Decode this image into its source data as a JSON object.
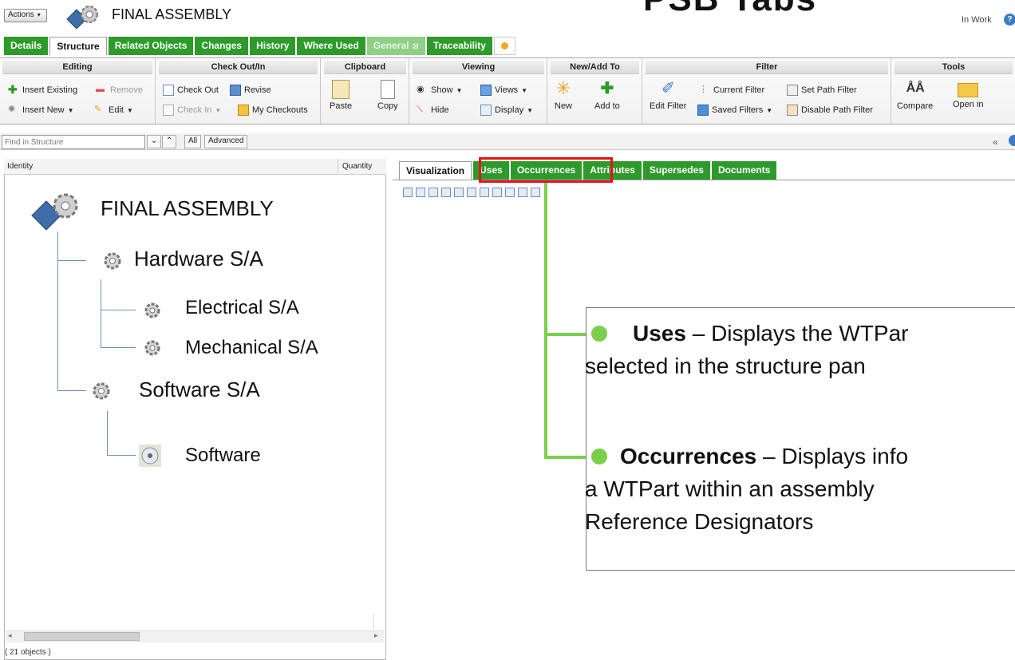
{
  "header": {
    "actions_label": "Actions",
    "title": "FINAL ASSEMBLY",
    "overlay_title": "PSB Tabs",
    "status": "In Work"
  },
  "tabs": [
    {
      "label": "Details"
    },
    {
      "label": "Structure",
      "active": true
    },
    {
      "label": "Related Objects"
    },
    {
      "label": "Changes"
    },
    {
      "label": "History"
    },
    {
      "label": "Where Used"
    },
    {
      "label": "General",
      "dim": true,
      "close": "⊠"
    },
    {
      "label": "Traceability"
    }
  ],
  "ribbon": {
    "editing": {
      "title": "Editing",
      "insert_existing": "Insert Existing",
      "remove": "Remove",
      "insert_new": "Insert New",
      "edit": "Edit"
    },
    "checkout": {
      "title": "Check Out/In",
      "check_out": "Check Out",
      "revise": "Revise",
      "check_in": "Check In",
      "my_checkouts": "My Checkouts"
    },
    "clipboard": {
      "title": "Clipboard",
      "paste": "Paste",
      "copy": "Copy"
    },
    "viewing": {
      "title": "Viewing",
      "show": "Show",
      "views": "Views",
      "hide": "Hide",
      "display": "Display"
    },
    "newadd": {
      "title": "New/Add To",
      "new": "New",
      "add_to": "Add to"
    },
    "filter": {
      "title": "Filter",
      "edit_filter": "Edit Filter",
      "current_filter": "Current Filter",
      "set_path_filter": "Set Path Filter",
      "saved_filters": "Saved Filters",
      "disable_path_filter": "Disable Path Filter"
    },
    "tools": {
      "title": "Tools",
      "compare": "Compare",
      "open_in": "Open in"
    }
  },
  "findbar": {
    "placeholder": "Find in Structure",
    "all": "All",
    "advanced": "Advanced"
  },
  "left_panel": {
    "col_identity": "Identity",
    "col_quantity": "Quantity",
    "tree": [
      {
        "label": "FINAL ASSEMBLY"
      },
      {
        "label": "Hardware S/A"
      },
      {
        "label": "Electrical S/A"
      },
      {
        "label": "Mechanical S/A"
      },
      {
        "label": "Software S/A"
      },
      {
        "label": "Software"
      }
    ],
    "object_count": "( 21 objects )"
  },
  "right_tabs": [
    {
      "label": "Visualization",
      "active": true
    },
    {
      "label": "Uses"
    },
    {
      "label": "Occurrences"
    },
    {
      "label": "Attributes"
    },
    {
      "label": "Supersedes"
    },
    {
      "label": "Documents"
    }
  ],
  "callout": {
    "uses_term": "Uses",
    "uses_line1": " – Displays the WTPar",
    "uses_line2": "selected in the structure pan",
    "occ_term": "Occurrences",
    "occ_line1": " – Displays info",
    "occ_line2": "a WTPart within an assembly",
    "occ_line3": "Reference Designators"
  },
  "colors": {
    "tab_green": "#2e9a2b",
    "callout_green": "#7ccf4b",
    "highlight_red": "#e8101a"
  }
}
